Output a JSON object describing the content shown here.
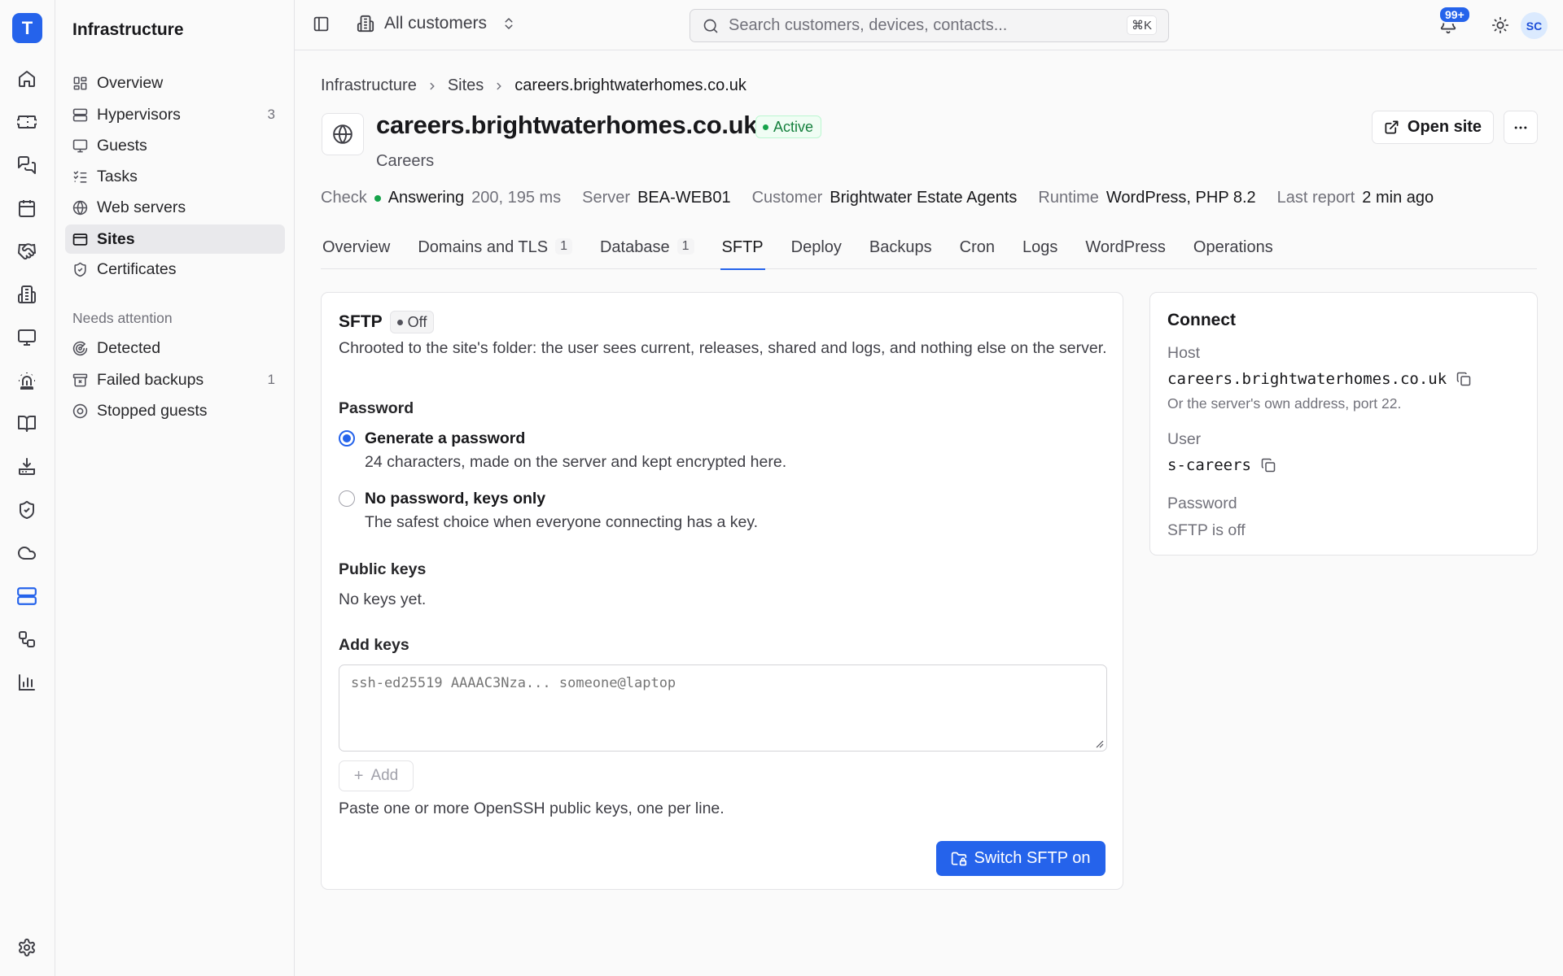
{
  "app": {
    "logo_letter": "T",
    "section_title": "Infrastructure"
  },
  "rail": {
    "items": [
      "home-icon",
      "ticket-icon",
      "messages-icon",
      "calendar-icon",
      "handshake-icon",
      "building-icon",
      "monitor-icon",
      "siren-icon",
      "book-icon",
      "download-icon",
      "shield-icon",
      "cloud-icon",
      "server-icon",
      "workflow-icon",
      "chart-icon"
    ],
    "active": "server-icon",
    "settings": "settings-icon"
  },
  "sidebar": {
    "items": [
      {
        "label": "Overview",
        "icon": "dashboard-icon"
      },
      {
        "label": "Hypervisors",
        "icon": "server-icon",
        "count": "3"
      },
      {
        "label": "Guests",
        "icon": "monitor-icon"
      },
      {
        "label": "Tasks",
        "icon": "list-checks-icon"
      },
      {
        "label": "Web servers",
        "icon": "globe-icon"
      },
      {
        "label": "Sites",
        "icon": "browser-icon",
        "active": true
      },
      {
        "label": "Certificates",
        "icon": "badge-check-icon"
      }
    ],
    "attention_label": "Needs attention",
    "attention": [
      {
        "label": "Detected",
        "icon": "radar-icon"
      },
      {
        "label": "Failed backups",
        "icon": "archive-x-icon",
        "count": "1"
      },
      {
        "label": "Stopped guests",
        "icon": "stop-circle-icon"
      }
    ]
  },
  "topbar": {
    "customer_scope": "All customers",
    "search_placeholder": "Search customers, devices, contacts...",
    "search_shortcut": "⌘K",
    "notifications_badge": "99+",
    "avatar_initials": "SC"
  },
  "breadcrumb": [
    "Infrastructure",
    "Sites",
    "careers.brightwaterhomes.co.uk"
  ],
  "site": {
    "title": "careers.brightwaterhomes.co.uk",
    "status": "Active",
    "subtitle": "Careers",
    "open_site_label": "Open site"
  },
  "meta": {
    "check_label": "Check",
    "check_value": "Answering",
    "check_detail": "200, 195 ms",
    "server_label": "Server",
    "server_value": "BEA-WEB01",
    "customer_label": "Customer",
    "customer_value": "Brightwater Estate Agents",
    "runtime_label": "Runtime",
    "runtime_value": "WordPress, PHP 8.2",
    "last_report_label": "Last report",
    "last_report_value": "2 min ago"
  },
  "tabs": [
    {
      "label": "Overview"
    },
    {
      "label": "Domains and TLS",
      "count": "1"
    },
    {
      "label": "Database",
      "count": "1"
    },
    {
      "label": "SFTP",
      "active": true
    },
    {
      "label": "Deploy"
    },
    {
      "label": "Backups"
    },
    {
      "label": "Cron"
    },
    {
      "label": "Logs"
    },
    {
      "label": "WordPress"
    },
    {
      "label": "Operations"
    }
  ],
  "sftp": {
    "title": "SFTP",
    "status": "Off",
    "description": "Chrooted to the site's folder: the user sees current, releases, shared and logs, and nothing else on the server.",
    "password_label": "Password",
    "option_generate_title": "Generate a password",
    "option_generate_desc": "24 characters, made on the server and kept encrypted here.",
    "option_keys_title": "No password, keys only",
    "option_keys_desc": "The safest choice when everyone connecting has a key.",
    "public_keys_label": "Public keys",
    "public_keys_empty": "No keys yet.",
    "add_keys_label": "Add keys",
    "add_keys_placeholder": "ssh-ed25519 AAAAC3Nza... someone@laptop",
    "add_button": "Add",
    "add_hint": "Paste one or more OpenSSH public keys, one per line.",
    "switch_button": "Switch SFTP on"
  },
  "connect": {
    "title": "Connect",
    "host_label": "Host",
    "host_value": "careers.brightwaterhomes.co.uk",
    "host_hint": "Or the server's own address, port 22.",
    "user_label": "User",
    "user_value": "s-careers",
    "password_label": "Password",
    "password_value": "SFTP is off"
  },
  "colors": {
    "accent": "#2563eb",
    "success": "#16a34a"
  }
}
